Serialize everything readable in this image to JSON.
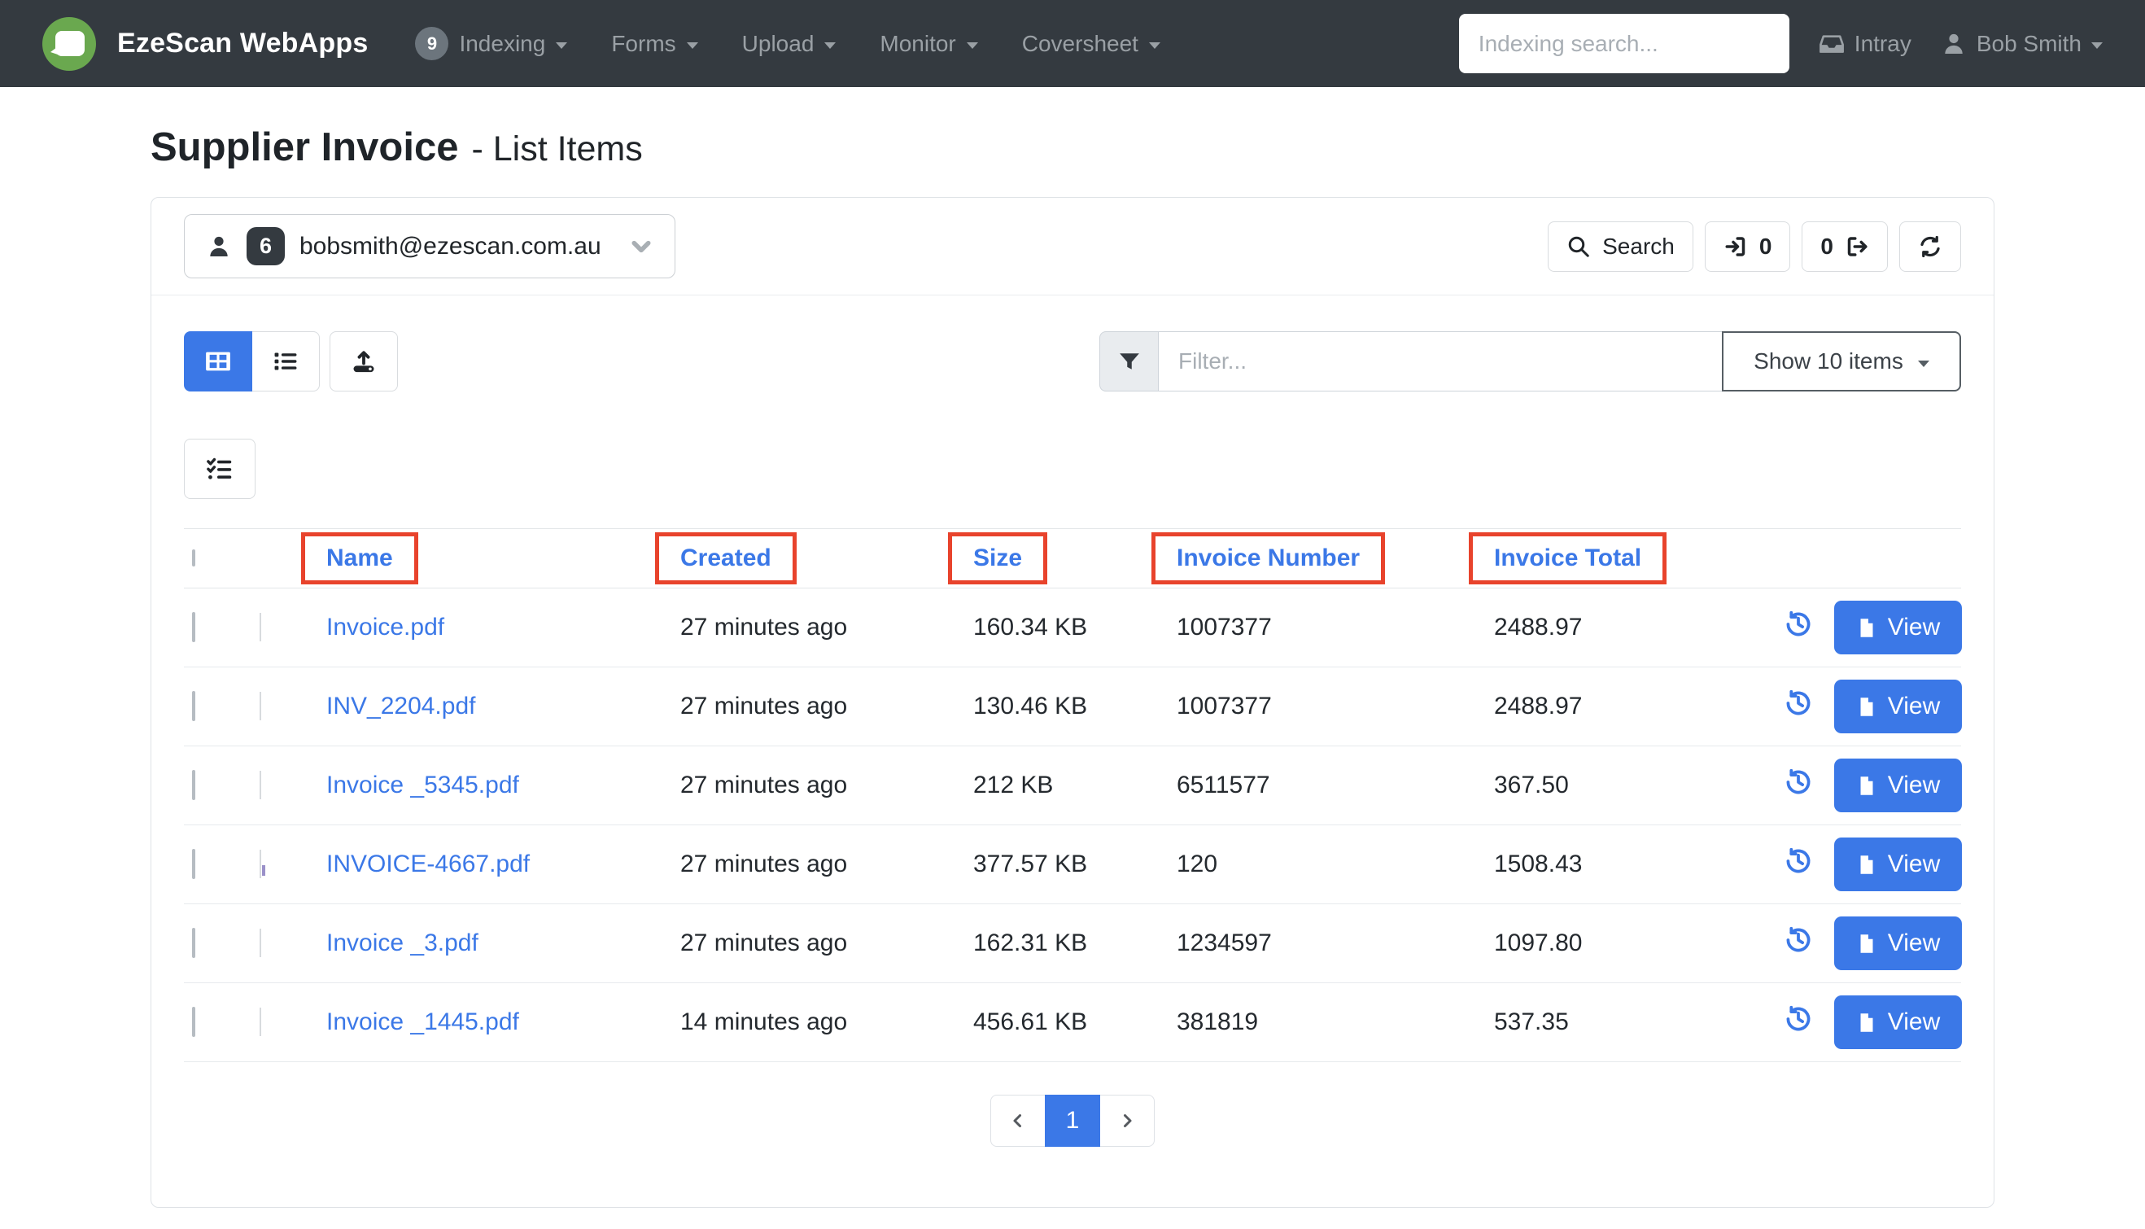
{
  "colors": {
    "accent": "#3b78e7",
    "annotation_red": "#e8432c",
    "navbar_bg": "#343a40",
    "logo_green": "#6aa84f"
  },
  "icons": {
    "brand": "ezescan-logo",
    "menu_caret": "chevron-down-icon",
    "intray": "inbox-icon",
    "user": "person-icon",
    "search": "magnifier-icon",
    "checkin": "sign-in-icon",
    "checkout": "sign-out-icon",
    "refresh": "refresh-icon",
    "grid_view": "table-icon",
    "list_view": "list-icon",
    "upload": "upload-tray-icon",
    "filter": "funnel-icon",
    "batch_select": "checklist-icon",
    "history": "history-icon",
    "view_file": "file-icon",
    "prev": "chevron-left-icon",
    "next": "chevron-right-icon"
  },
  "navbar": {
    "brand": "EzeScan WebApps",
    "menu": [
      {
        "label": "Indexing",
        "badge": "9"
      },
      {
        "label": "Forms"
      },
      {
        "label": "Upload"
      },
      {
        "label": "Monitor"
      },
      {
        "label": "Coversheet"
      }
    ],
    "search_placeholder": "Indexing search...",
    "intray_label": "Intray",
    "user_label": "Bob Smith"
  },
  "page": {
    "title": "Supplier Invoice",
    "subtitle": "- List Items"
  },
  "panel": {
    "user_email": "bobsmith@ezescan.com.au",
    "user_badge": "6",
    "search_label": "Search",
    "checkin_count": "0",
    "checkout_count": "0"
  },
  "toolbar": {
    "filter_placeholder": "Filter...",
    "show_items_label": "Show 10 items"
  },
  "table": {
    "headers": [
      "Name",
      "Created",
      "Size",
      "Invoice Number",
      "Invoice Total"
    ],
    "view_label": "View",
    "rows": [
      {
        "name": "Invoice.pdf",
        "created": "27 minutes ago",
        "size": "160.34 KB",
        "invoice_number": "1007377",
        "invoice_total": "2488.97"
      },
      {
        "name": "INV_2204.pdf",
        "created": "27 minutes ago",
        "size": "130.46 KB",
        "invoice_number": "1007377",
        "invoice_total": "2488.97"
      },
      {
        "name": "Invoice _5345.pdf",
        "created": "27 minutes ago",
        "size": "212 KB",
        "invoice_number": "6511577",
        "invoice_total": "367.50"
      },
      {
        "name": "INVOICE-4667.pdf",
        "created": "27 minutes ago",
        "size": "377.57 KB",
        "invoice_number": "120",
        "invoice_total": "1508.43"
      },
      {
        "name": "Invoice _3.pdf",
        "created": "27 minutes ago",
        "size": "162.31 KB",
        "invoice_number": "1234597",
        "invoice_total": "1097.80"
      },
      {
        "name": "Invoice _1445.pdf",
        "created": "14 minutes ago",
        "size": "456.61 KB",
        "invoice_number": "381819",
        "invoice_total": "537.35"
      }
    ]
  },
  "pagination": {
    "current_page": "1"
  }
}
